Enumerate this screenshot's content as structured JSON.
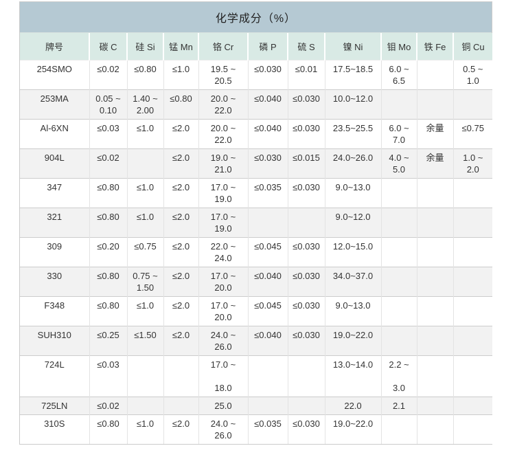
{
  "table": {
    "title": "化学成分（%）",
    "columns": [
      "牌号",
      "碳 C",
      "硅 Si",
      "锰 Mn",
      "铬 Cr",
      "磷 P",
      "硫 S",
      "镍 Ni",
      "钼 Mo",
      "铁 Fe",
      "铜 Cu"
    ],
    "rows": [
      [
        "254SMO",
        "≤0.02",
        "≤0.80",
        "≤1.0",
        "19.5 ~\n20.5",
        "≤0.030",
        "≤0.01",
        "17.5~18.5",
        "6.0 ~\n6.5",
        "",
        "0.5 ~\n1.0"
      ],
      [
        "253MA",
        "0.05 ~\n0.10",
        "1.40 ~\n2.00",
        "≤0.80",
        "20.0 ~\n22.0",
        "≤0.040",
        "≤0.030",
        "10.0~12.0",
        "",
        "",
        ""
      ],
      [
        "Al-6XN",
        "≤0.03",
        "≤1.0",
        "≤2.0",
        "20.0 ~\n22.0",
        "≤0.040",
        "≤0.030",
        "23.5~25.5",
        "6.0 ~\n7.0",
        "余量",
        "≤0.75"
      ],
      [
        "904L",
        "≤0.02",
        "",
        "≤2.0",
        "19.0 ~\n21.0",
        "≤0.030",
        "≤0.015",
        "24.0~26.0",
        "4.0 ~\n5.0",
        "余量",
        "1.0 ~\n2.0"
      ],
      [
        "347",
        "≤0.80",
        "≤1.0",
        "≤2.0",
        "17.0 ~\n19.0",
        "≤0.035",
        "≤0.030",
        "9.0~13.0",
        "",
        "",
        ""
      ],
      [
        "321",
        "≤0.80",
        "≤1.0",
        "≤2.0",
        "17.0 ~\n19.0",
        "",
        "",
        "9.0~12.0",
        "",
        "",
        ""
      ],
      [
        "309",
        "≤0.20",
        "≤0.75",
        "≤2.0",
        "22.0 ~\n24.0",
        "≤0.045",
        "≤0.030",
        "12.0~15.0",
        "",
        "",
        ""
      ],
      [
        "330",
        "≤0.80",
        "0.75 ~\n1.50",
        "≤2.0",
        "17.0 ~\n20.0",
        "≤0.040",
        "≤0.030",
        "34.0~37.0",
        "",
        "",
        ""
      ],
      [
        "F348",
        "≤0.80",
        "≤1.0",
        "≤2.0",
        "17.0 ~\n20.0",
        "≤0.045",
        "≤0.030",
        "9.0~13.0",
        "",
        "",
        ""
      ],
      [
        "SUH310",
        "≤0.25",
        "≤1.50",
        "≤2.0",
        "24.0 ~\n26.0",
        "≤0.040",
        "≤0.030",
        "19.0~22.0",
        "",
        "",
        ""
      ],
      [
        "724L",
        "≤0.03",
        "",
        "",
        "17.0 ~\n\n18.0",
        "",
        "",
        "13.0~14.0",
        "2.2 ~\n\n3.0",
        "",
        ""
      ],
      [
        "725LN",
        "≤0.02",
        "",
        "",
        "25.0",
        "",
        "",
        "22.0",
        "2.1",
        "",
        ""
      ],
      [
        "310S",
        "≤0.80",
        "≤1.0",
        "≤2.0",
        "24.0 ~\n26.0",
        "≤0.035",
        "≤0.030",
        "19.0~22.0",
        "",
        "",
        ""
      ]
    ]
  },
  "colors": {
    "title_bar_bg": "#b5c9d3",
    "header_row_bg": "#d9eae5",
    "row_even_bg": "#f2f2f2",
    "row_odd_bg": "#ffffff",
    "border_outer": "#cbcbcb",
    "border_inner_vertical": "#e3e3e3",
    "border_inner_horizontal": "#cccccc",
    "text": "#333333"
  }
}
